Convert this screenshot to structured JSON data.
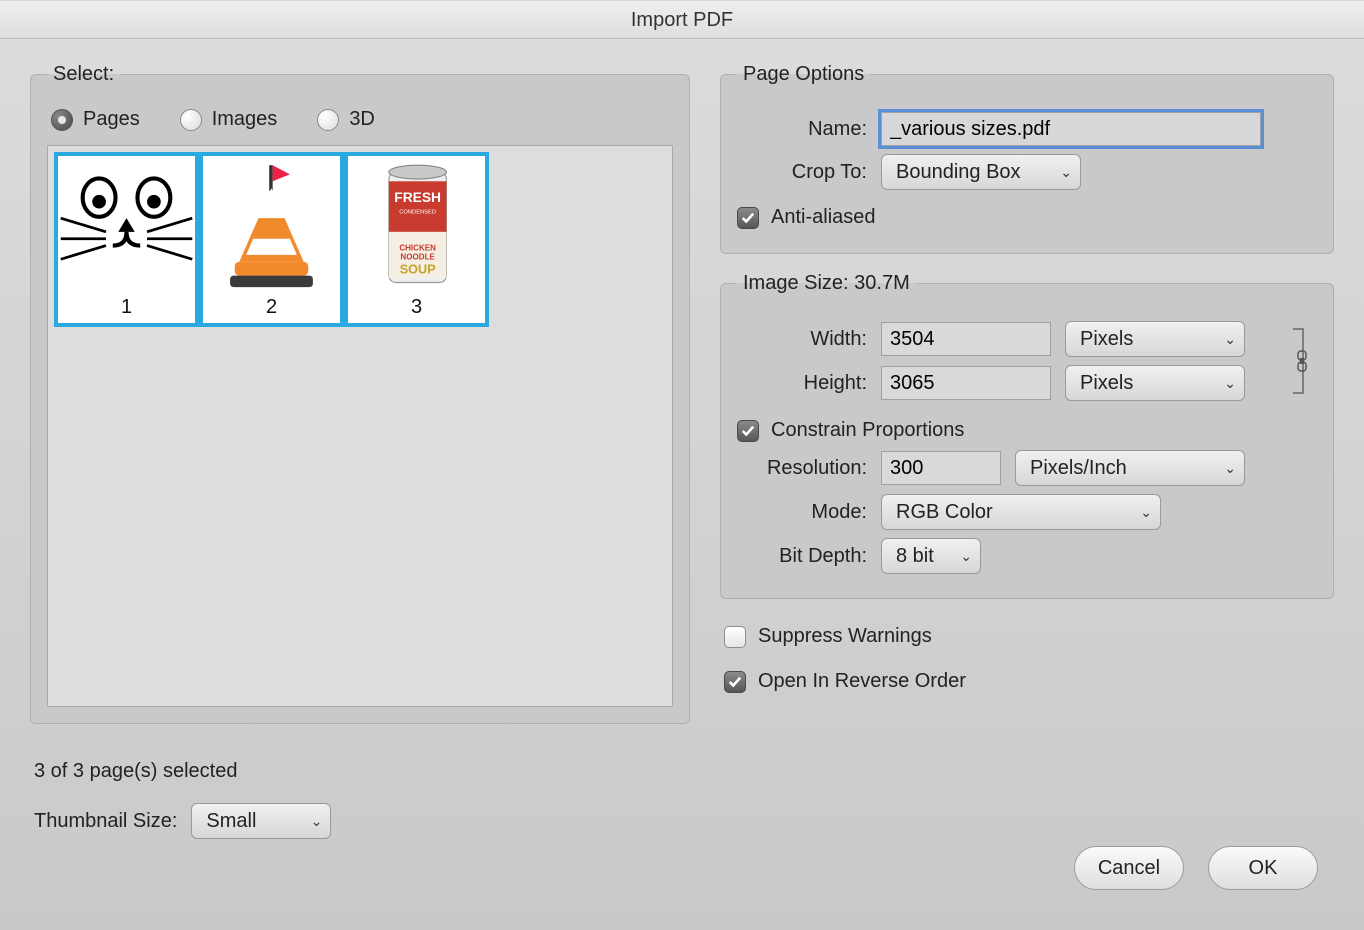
{
  "title": "Import PDF",
  "select": {
    "legend": "Select:",
    "modes": [
      {
        "label": "Pages",
        "selected": true
      },
      {
        "label": "Images",
        "selected": false
      },
      {
        "label": "3D",
        "selected": false
      }
    ],
    "thumbs": [
      "1",
      "2",
      "3"
    ],
    "status": "3 of 3 page(s) selected",
    "thumb_size_label": "Thumbnail Size:",
    "thumb_size_value": "Small"
  },
  "page_options": {
    "legend": "Page Options",
    "name_label": "Name:",
    "name_value": "_various sizes.pdf",
    "crop_label": "Crop To:",
    "crop_value": "Bounding Box",
    "anti_aliased_label": "Anti-aliased",
    "anti_aliased_checked": true
  },
  "image_size": {
    "legend": "Image Size: 30.7M",
    "width_label": "Width:",
    "width_value": "3504",
    "width_unit": "Pixels",
    "height_label": "Height:",
    "height_value": "3065",
    "height_unit": "Pixels",
    "constrain_label": "Constrain Proportions",
    "constrain_checked": true,
    "resolution_label": "Resolution:",
    "resolution_value": "300",
    "resolution_unit": "Pixels/Inch",
    "mode_label": "Mode:",
    "mode_value": "RGB Color",
    "bitdepth_label": "Bit Depth:",
    "bitdepth_value": "8 bit"
  },
  "suppress_label": "Suppress Warnings",
  "suppress_checked": false,
  "reverse_label": "Open In Reverse Order",
  "reverse_checked": true,
  "buttons": {
    "cancel": "Cancel",
    "ok": "OK"
  }
}
